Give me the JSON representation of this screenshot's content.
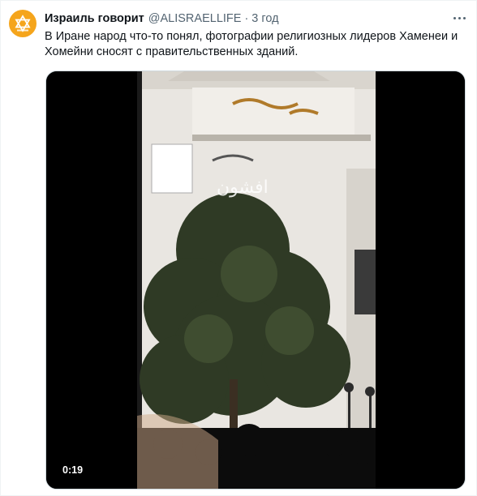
{
  "tweet": {
    "author_name": "Израиль говорит",
    "author_handle": "@ALISRAELLIFE",
    "separator": "·",
    "timestamp": "3 год",
    "text": "В Иране народ что-то понял, фотографии религиозных лидеров Хаменеи и Хомейни сносят с правительственных зданий.",
    "avatar_icon": "star-of-david-icon",
    "more_icon": "more-options-icon"
  },
  "media": {
    "duration": "0:19",
    "watermark": "افشون",
    "accent_color": "#f5a51c"
  }
}
